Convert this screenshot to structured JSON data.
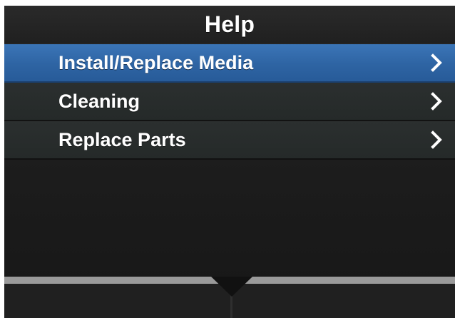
{
  "header": {
    "title": "Help"
  },
  "menu": {
    "items": [
      {
        "label": "Install/Replace Media",
        "selected": true,
        "icon": "chevron-right-icon"
      },
      {
        "label": "Cleaning",
        "selected": false,
        "icon": "chevron-right-icon"
      },
      {
        "label": "Replace Parts",
        "selected": false,
        "icon": "chevron-right-icon"
      }
    ]
  },
  "colors": {
    "background": "#1c1c1c",
    "selected": "#2e64a3",
    "text": "#ffffff",
    "divider": "#9a9a9a"
  }
}
